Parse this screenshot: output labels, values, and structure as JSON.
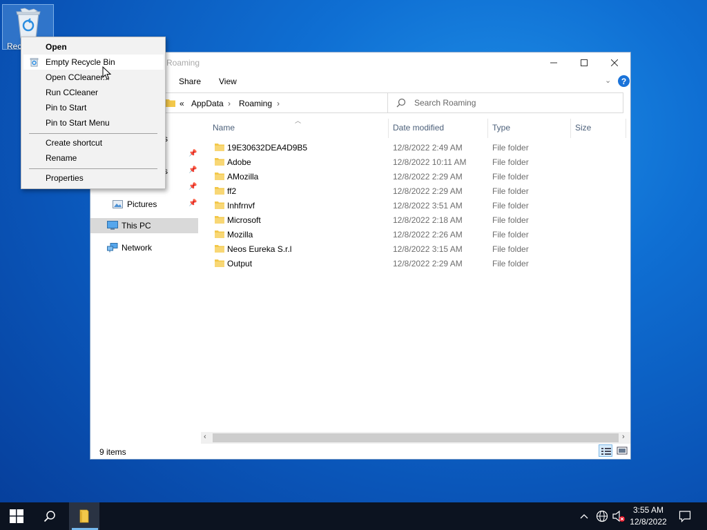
{
  "desktop": {
    "recycle_bin_label": "Recyc"
  },
  "window": {
    "title": "Roaming",
    "ribbon_tabs": [
      "Share",
      "View"
    ],
    "help_label": "?",
    "address": {
      "overflow": "«",
      "segments": [
        "AppData",
        "Roaming"
      ],
      "separator": "›"
    },
    "search_placeholder": "Search Roaming",
    "nav": {
      "quick_access_partial": [
        "s",
        "s",
        "Downloads"
      ],
      "pictures": "Pictures",
      "this_pc": "This PC",
      "network": "Network"
    },
    "columns": {
      "name": "Name",
      "date": "Date modified",
      "type": "Type",
      "size": "Size"
    },
    "files": [
      {
        "name": "19E30632DEA4D9B5",
        "date": "12/8/2022 2:49 AM",
        "type": "File folder"
      },
      {
        "name": "Adobe",
        "date": "12/8/2022 10:11 AM",
        "type": "File folder"
      },
      {
        "name": "AMozilla",
        "date": "12/8/2022 2:29 AM",
        "type": "File folder"
      },
      {
        "name": "ff2",
        "date": "12/8/2022 2:29 AM",
        "type": "File folder"
      },
      {
        "name": "Inhfrnvf",
        "date": "12/8/2022 3:51 AM",
        "type": "File folder"
      },
      {
        "name": "Microsoft",
        "date": "12/8/2022 2:18 AM",
        "type": "File folder"
      },
      {
        "name": "Mozilla",
        "date": "12/8/2022 2:26 AM",
        "type": "File folder"
      },
      {
        "name": "Neos Eureka S.r.l",
        "date": "12/8/2022 3:15 AM",
        "type": "File folder"
      },
      {
        "name": "Output",
        "date": "12/8/2022 2:29 AM",
        "type": "File folder"
      }
    ],
    "status": "9 items"
  },
  "context_menu": {
    "items": {
      "open": "Open",
      "empty": "Empty Recycle Bin",
      "open_ccleaner": "Open CCleaner...",
      "run_ccleaner": "Run CCleaner",
      "pin_start": "Pin to Start",
      "pin_start_menu": "Pin to Start Menu",
      "create_shortcut": "Create shortcut",
      "rename": "Rename",
      "properties": "Properties"
    }
  },
  "taskbar": {
    "time": "3:55 AM",
    "date": "12/8/2022"
  },
  "colors": {
    "accent": "#1a73d9",
    "taskbar": "#0c1320",
    "selection": "#d9d9d9"
  }
}
